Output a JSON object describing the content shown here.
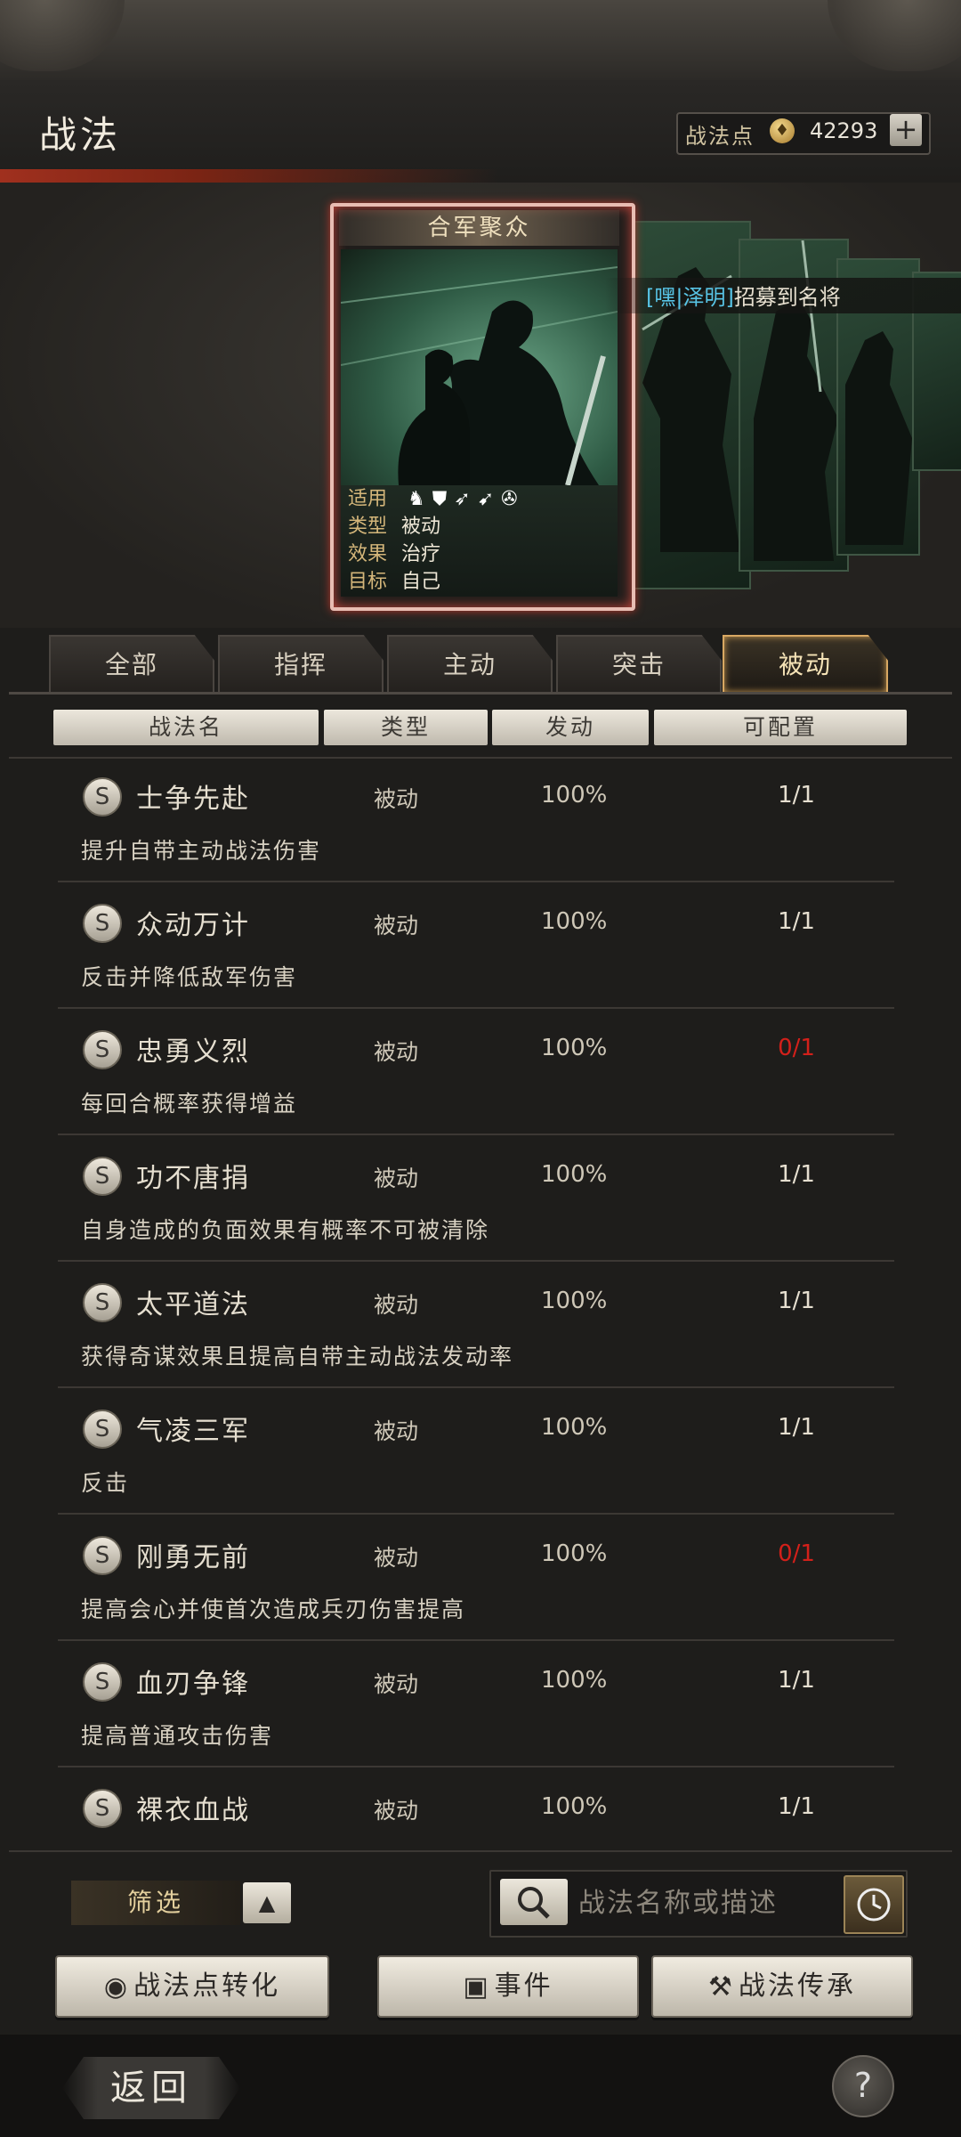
{
  "header": {
    "title": "战法",
    "points_label": "战法点",
    "points_value": "42293",
    "add_label": "+"
  },
  "featured_card": {
    "name": "合军聚众",
    "info": [
      {
        "key": "适用",
        "value": ""
      },
      {
        "key": "类型",
        "value": "被动"
      },
      {
        "key": "效果",
        "value": "治疗"
      },
      {
        "key": "目标",
        "value": "自己"
      }
    ],
    "applicable_icons": [
      "cavalry-icon",
      "shield-icon",
      "bow-icon",
      "spear-icon",
      "siege-icon"
    ]
  },
  "recruit_notice": {
    "name": "[嘿|泽明]",
    "text": "招募到名将"
  },
  "tabs": [
    {
      "label": "全部"
    },
    {
      "label": "指挥"
    },
    {
      "label": "主动"
    },
    {
      "label": "突击"
    },
    {
      "label": "被动",
      "active": true
    }
  ],
  "columns": {
    "name": "战法名",
    "type": "类型",
    "rate": "发动",
    "config": "可配置"
  },
  "rows": [
    {
      "grade": "S",
      "name": "士争先赴",
      "type": "被动",
      "rate": "100%",
      "count": "1/1",
      "desc": "提升自带主动战法伤害"
    },
    {
      "grade": "S",
      "name": "众动万计",
      "type": "被动",
      "rate": "100%",
      "count": "1/1",
      "desc": "反击并降低敌军伤害"
    },
    {
      "grade": "S",
      "name": "忠勇义烈",
      "type": "被动",
      "rate": "100%",
      "count": "0/1",
      "desc": "每回合概率获得增益"
    },
    {
      "grade": "S",
      "name": "功不唐捐",
      "type": "被动",
      "rate": "100%",
      "count": "1/1",
      "desc": "自身造成的负面效果有概率不可被清除"
    },
    {
      "grade": "S",
      "name": "太平道法",
      "type": "被动",
      "rate": "100%",
      "count": "1/1",
      "desc": "获得奇谋效果且提高自带主动战法发动率"
    },
    {
      "grade": "S",
      "name": "气凌三军",
      "type": "被动",
      "rate": "100%",
      "count": "1/1",
      "desc": "反击"
    },
    {
      "grade": "S",
      "name": "刚勇无前",
      "type": "被动",
      "rate": "100%",
      "count": "0/1",
      "desc": "提高会心并使首次造成兵刃伤害提高"
    },
    {
      "grade": "S",
      "name": "血刃争锋",
      "type": "被动",
      "rate": "100%",
      "count": "1/1",
      "desc": "提高普通攻击伤害"
    },
    {
      "grade": "S",
      "name": "裸衣血战",
      "type": "被动",
      "rate": "100%",
      "count": "1/1",
      "desc": ""
    }
  ],
  "filter": {
    "label": "筛选",
    "arrow": "▲"
  },
  "search": {
    "placeholder": "战法名称或描述"
  },
  "actions": {
    "convert": "战法点转化",
    "events": "事件",
    "inherit": "战法传承"
  },
  "footer": {
    "back": "返回",
    "help": "?"
  },
  "colors": {
    "accent_gold": "#d8a863",
    "unavailable_red": "#d3201a",
    "recruit_name_blue": "#58c4e6"
  }
}
